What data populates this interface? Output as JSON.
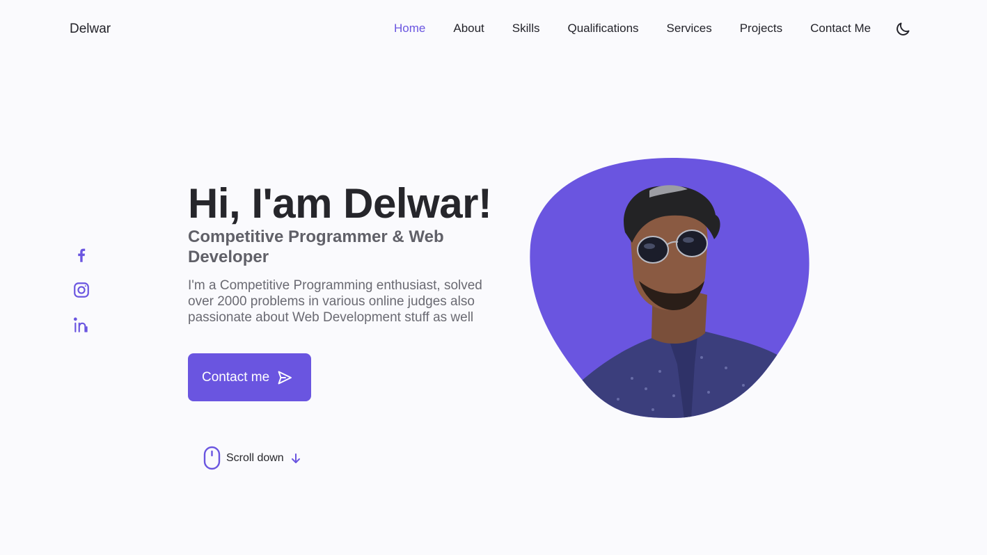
{
  "header": {
    "logo": "Delwar",
    "nav": [
      {
        "label": "Home",
        "active": true
      },
      {
        "label": "About",
        "active": false
      },
      {
        "label": "Skills",
        "active": false
      },
      {
        "label": "Qualifications",
        "active": false
      },
      {
        "label": "Services",
        "active": false
      },
      {
        "label": "Projects",
        "active": false
      },
      {
        "label": "Contact Me",
        "active": false
      }
    ],
    "theme_icon": "moon-icon"
  },
  "socials": [
    {
      "icon": "facebook-icon"
    },
    {
      "icon": "instagram-icon"
    },
    {
      "icon": "linkedin-icon"
    }
  ],
  "hero": {
    "title": "Hi, I'am Delwar!",
    "subtitle": "Competitive Programmer & Web Developer",
    "description": "I'm a Competitive Programming enthusiast, solved over 2000 problems in various online judges also passionate about Web Development stuff as well",
    "button_label": "Contact me",
    "button_icon": "send-icon",
    "scroll_label": "Scroll down",
    "scroll_icon": "mouse-icon"
  },
  "colors": {
    "accent": "#6a55e0",
    "background": "#fafafd",
    "text": "#23232a"
  }
}
